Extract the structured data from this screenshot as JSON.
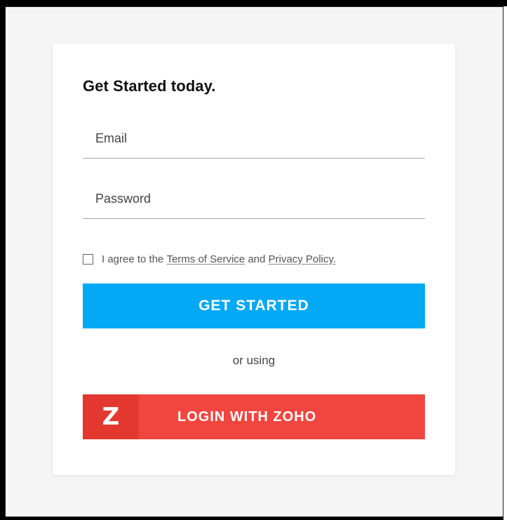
{
  "card": {
    "title": "Get Started today."
  },
  "form": {
    "email_placeholder": "Email",
    "password_placeholder": "Password",
    "agree_prefix": "I agree to the",
    "terms_link": "Terms of Service",
    "agree_and": "and",
    "privacy_link": "Privacy Policy.",
    "agree_checked": false,
    "get_started_label": "GET STARTED",
    "or_using": "or using",
    "zoho_logo_letter": "Z",
    "zoho_label": "LOGIN WITH ZOHO"
  },
  "colors": {
    "primary_button": "#03a9f4",
    "zoho_button": "#f1463f",
    "zoho_logo_block": "#e3382f"
  }
}
